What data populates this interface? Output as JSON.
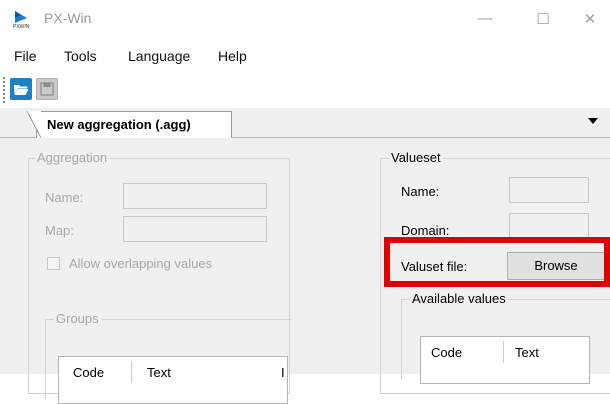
{
  "window": {
    "title": "PX-Win",
    "controls": {
      "minimize": "—",
      "maximize": "☐",
      "close": "✕"
    }
  },
  "menu": [
    "File",
    "Tools",
    "Language",
    "Help"
  ],
  "toolbar": {
    "open_icon": "folder-open-icon",
    "save_icon": "save-icon"
  },
  "tab": {
    "label": "New aggregation (.agg)"
  },
  "aggregation": {
    "title": "Aggregation",
    "name_label": "Name:",
    "map_label": "Map:",
    "overlap_label": "Allow overlapping values",
    "groups": {
      "title": "Groups",
      "columns": [
        "Code",
        "Text",
        "I"
      ]
    }
  },
  "valueset": {
    "title": "Valueset",
    "name_label": "Name:",
    "domain_label": "Domain:",
    "file_label": "Valuset file:",
    "browse_label": "Browse",
    "available": {
      "title": "Available values",
      "columns": [
        "Code",
        "Text"
      ]
    }
  },
  "colors": {
    "accent": "#1e7fc3",
    "highlight": "#e10000",
    "disabled_text": "#a8a8a8"
  }
}
